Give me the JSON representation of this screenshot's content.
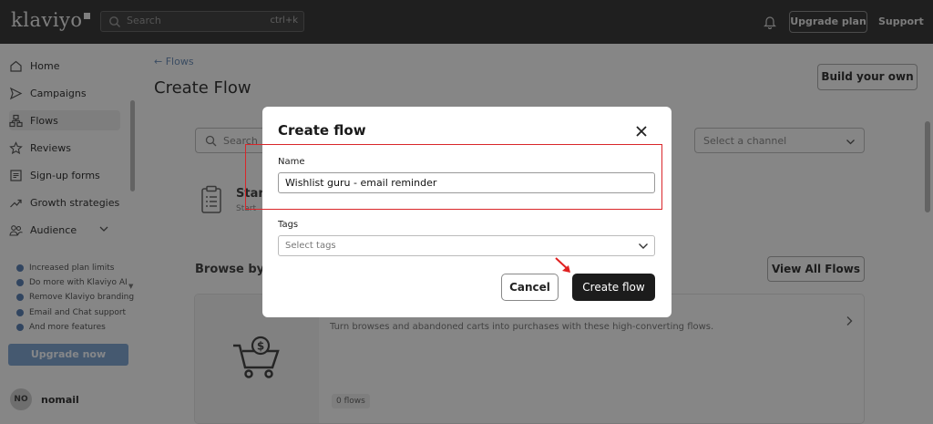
{
  "topbar": {
    "logo": "klaviyo",
    "search_placeholder": "Search",
    "search_shortcut": "ctrl+k",
    "upgrade_plan": "Upgrade plan",
    "support": "Support"
  },
  "sidebar": {
    "items": [
      {
        "label": "Home",
        "icon": "home-icon"
      },
      {
        "label": "Campaigns",
        "icon": "send-icon"
      },
      {
        "label": "Flows",
        "icon": "flows-icon",
        "active": true
      },
      {
        "label": "Reviews",
        "icon": "star-icon"
      },
      {
        "label": "Sign-up forms",
        "icon": "form-icon"
      },
      {
        "label": "Growth strategies",
        "icon": "trend-icon"
      },
      {
        "label": "Audience",
        "icon": "people-icon",
        "expandable": true
      }
    ],
    "perks": [
      "Increased plan limits",
      "Do more with Klaviyo AI",
      "Remove Klaviyo branding",
      "Email and Chat support",
      "And more features"
    ],
    "upgrade_now": "Upgrade now",
    "user": {
      "initials": "NO",
      "name": "nomail"
    }
  },
  "main": {
    "back_link": "← Flows",
    "title": "Create Flow",
    "build_own": "Build your own",
    "search_placeholder": "Search",
    "channel_placeholder": "Select a channel",
    "start_card_title": "Star",
    "start_card_sub": "Start",
    "browse_title": "Browse by",
    "view_all": "View All Flows",
    "flow_card": {
      "description": "Turn browses and abandoned carts into purchases with these high-converting flows.",
      "count": "0 flows"
    }
  },
  "modal": {
    "title": "Create flow",
    "name_label": "Name",
    "name_value": "Wishlist guru - email reminder",
    "tags_label": "Tags",
    "tags_placeholder": "Select tags",
    "cancel": "Cancel",
    "create": "Create flow"
  },
  "colors": {
    "topbar": "#3a3a3a",
    "highlight": "#d9262a",
    "primary_button": "#1c1c1c",
    "upgrade_now": "#7fa2cc"
  }
}
